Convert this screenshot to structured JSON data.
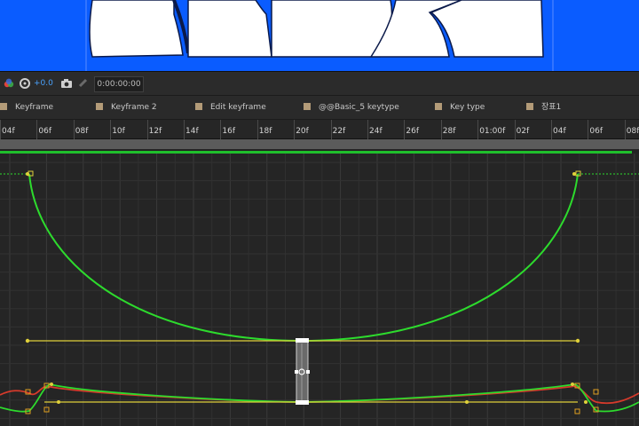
{
  "colors": {
    "preview_bg": "#0a5cff",
    "curve_green": "#2ddb2d",
    "curve_red": "#d63a2b",
    "handle_yellow": "#e0d13a",
    "work_area": "#1fbf2c"
  },
  "toolbar": {
    "color_icon": "color-wheel-icon",
    "exposure_icon": "exposure-icon",
    "exposure_value": "+0.0",
    "camera_icon": "camera-icon",
    "link_icon": "link-icon",
    "timecode": "0:00:00:00"
  },
  "labels": [
    {
      "text": "Keyframe"
    },
    {
      "text": "Keyframe 2"
    },
    {
      "text": "Edit keyframe"
    },
    {
      "text": "@@Basic_5 keytype"
    },
    {
      "text": "Key type"
    },
    {
      "text": "장표1"
    }
  ],
  "ruler": {
    "ticks": [
      "04f",
      "06f",
      "08f",
      "10f",
      "12f",
      "14f",
      "16f",
      "18f",
      "20f",
      "22f",
      "24f",
      "26f",
      "28f",
      "01:00f",
      "02f",
      "04f",
      "06f",
      "08f"
    ]
  }
}
